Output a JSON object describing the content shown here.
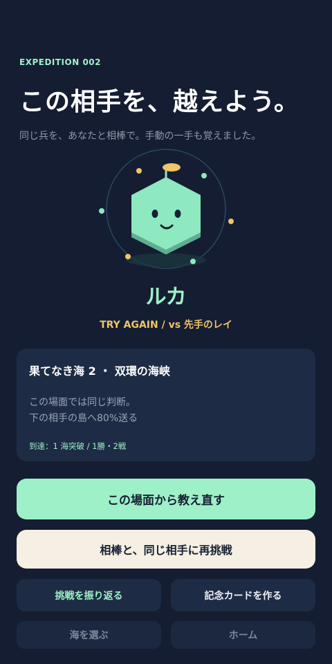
{
  "header": {
    "eyebrow": "EXPEDITION  002",
    "title": "この相手を、越えよう。",
    "subtitle": "同じ兵を、あなたと相棒で。手動の一手も覚えました。"
  },
  "partner": {
    "name": "ルカ",
    "tagline": "TRY AGAIN  /  vs 先手のレイ",
    "colors": {
      "body": "#8ee8c0",
      "shadow": "#5fae92",
      "accent": "#f0c46a"
    }
  },
  "stage_card": {
    "title": "果てなき海 2 ・ 双環の海峡",
    "lines": [
      "この場面では同じ判断。",
      "下の相手の島へ80%送る"
    ],
    "meta": "到達：1 海突破  /  1勝・2戦"
  },
  "actions": {
    "reteach": "この場面から教え直す",
    "rematch": "相棒と、同じ相手に再挑戦",
    "review": "挑戦を振り返る",
    "make_card": "記念カードを作る",
    "choose_sea": "海を選ぶ",
    "home": "ホーム"
  }
}
